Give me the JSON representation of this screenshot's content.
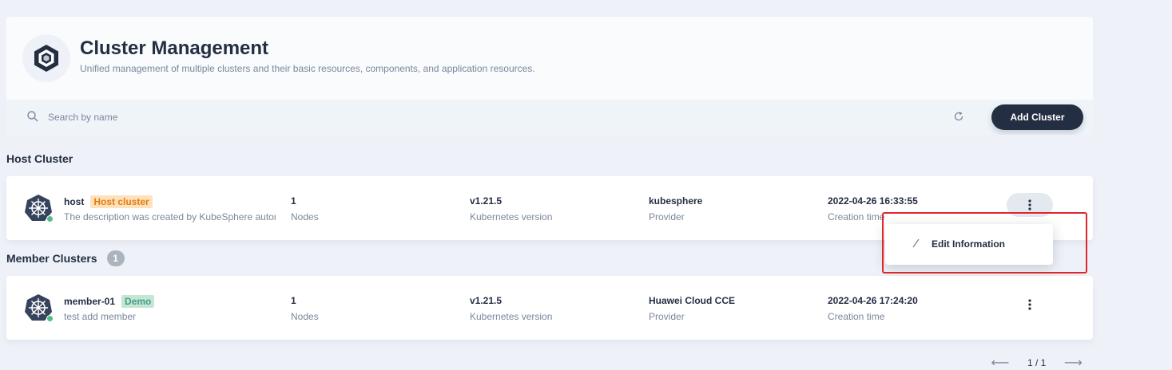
{
  "header": {
    "title": "Cluster Management",
    "subtitle": "Unified management of multiple clusters and their basic resources, components, and application resources."
  },
  "toolbar": {
    "search_placeholder": "Search by name",
    "add_button_label": "Add Cluster"
  },
  "host_section": {
    "title": "Host Cluster",
    "clusters": [
      {
        "name": "host",
        "tag": "Host cluster",
        "description": "The description was created by KubeSphere automatically.",
        "nodes": "1",
        "nodes_label": "Nodes",
        "version": "v1.21.5",
        "version_label": "Kubernetes version",
        "provider": "kubesphere",
        "provider_label": "Provider",
        "created": "2022-04-26 16:33:55",
        "created_label": "Creation time"
      }
    ]
  },
  "member_section": {
    "title": "Member Clusters",
    "count": "1",
    "clusters": [
      {
        "name": "member-01",
        "tag": "Demo",
        "description": "test add member",
        "nodes": "1",
        "nodes_label": "Nodes",
        "version": "v1.21.5",
        "version_label": "Kubernetes version",
        "provider": "Huawei Cloud CCE",
        "provider_label": "Provider",
        "created": "2022-04-26 17:24:20",
        "created_label": "Creation time"
      }
    ]
  },
  "dropdown": {
    "items": [
      {
        "label": "Edit Information",
        "icon": "pencil-icon"
      }
    ]
  },
  "pagination": {
    "text": "1 / 1"
  },
  "colors": {
    "primary_dark": "#242e42",
    "status_running": "#55bc8a",
    "highlight": "#e0252b",
    "host_tag_bg": "#ffe1be",
    "demo_tag_bg": "#c4e6d4"
  }
}
